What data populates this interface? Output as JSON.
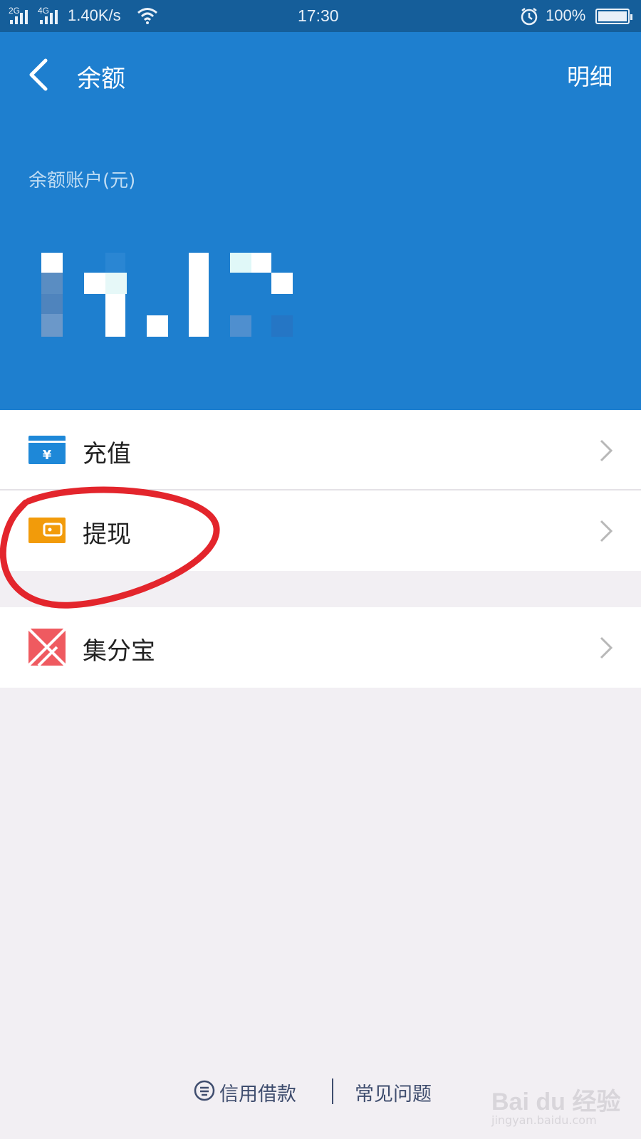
{
  "status_bar": {
    "signal_1": "2G",
    "signal_2": "4G",
    "net_speed": "1.40K/s",
    "time": "17:30",
    "battery": "100%"
  },
  "header": {
    "title": "余额",
    "detail_label": "明细",
    "account_label": "余额账户(元)"
  },
  "menu": {
    "items": [
      {
        "label": "充值",
        "icon": "yuan-card-icon"
      },
      {
        "label": "提现",
        "icon": "wallet-icon"
      },
      {
        "label": "集分宝",
        "icon": "jifenbao-icon"
      }
    ]
  },
  "footer": {
    "credit_label": "信用借款",
    "faq_label": "常见问题"
  },
  "watermark": {
    "main": "Bai du 经验",
    "sub": "jingyan.baidu.com"
  },
  "colors": {
    "header_blue": "#1e7fcf",
    "status_blue": "#155e9a",
    "annotation_red": "#e3252c",
    "wallet_orange": "#f29b0a",
    "card_blue": "#1e88d8"
  }
}
